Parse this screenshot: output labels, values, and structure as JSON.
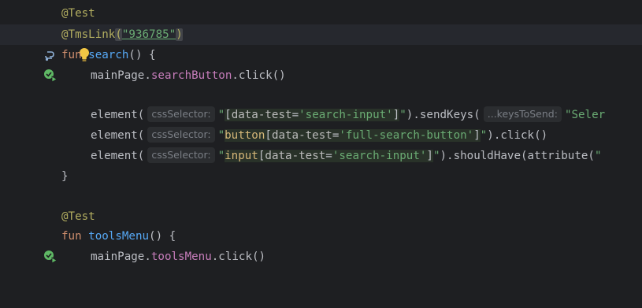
{
  "colors": {
    "background": "#1e1f22",
    "current_line": "#26282e",
    "annotation": "#b3ae60",
    "keyword": "#cf8e6d",
    "function": "#56a8f5",
    "property": "#c77dbb",
    "string": "#6aab73",
    "inlay_hint_bg": "#2b2d30",
    "bulb": "#f2c744",
    "run_icon": "#5fb865"
  },
  "icons": {
    "link_gutter": "allure-link-icon",
    "bulb": "lightbulb-icon",
    "run_test": "run-test-icon"
  },
  "lines": {
    "l1": {
      "annotation": "@Test"
    },
    "l2": {
      "annotation_name": "@TmsLink",
      "open": "(",
      "value": "\"936785\"",
      "close": ")"
    },
    "l3": {
      "keyword": "fun",
      "name": "search",
      "rest": "() {"
    },
    "l4": {
      "receiver": "mainPage",
      "dot1": ".",
      "prop": "searchButton",
      "call": ".click()"
    },
    "l6": {
      "fn": "element(",
      "hint": "cssSelector:",
      "q_open": "\"",
      "br_open": "[",
      "attr": "data-test",
      "eq": "=",
      "val": "'search-input'",
      "br_close": "]",
      "q_close": "\"",
      "rest": ").sendKeys(",
      "hint2": "...keysToSend:",
      "tail": "\"Seler"
    },
    "l7": {
      "fn": "element(",
      "hint": "cssSelector:",
      "q_open": "\"",
      "tag": "button",
      "br_open": "[",
      "attr": "data-test",
      "eq": "=",
      "val": "'full-search-button'",
      "br_close": "]",
      "q_close": "\"",
      "rest": ").click()"
    },
    "l8": {
      "fn": "element(",
      "hint": "cssSelector:",
      "q_open": "\"",
      "tag": "input",
      "br_open": "[",
      "attr": "data-test",
      "eq": "=",
      "val": "'search-input'",
      "br_close": "]",
      "q_close": "\"",
      "rest": ").shouldHave(attribute(",
      "tail": "\""
    },
    "l9": {
      "brace": "}"
    },
    "l11": {
      "annotation": "@Test"
    },
    "l12": {
      "keyword": "fun",
      "name": "toolsMenu",
      "rest": "() {"
    },
    "l13": {
      "receiver": "mainPage",
      "dot1": ".",
      "prop": "toolsMenu",
      "call": ".click()"
    }
  }
}
